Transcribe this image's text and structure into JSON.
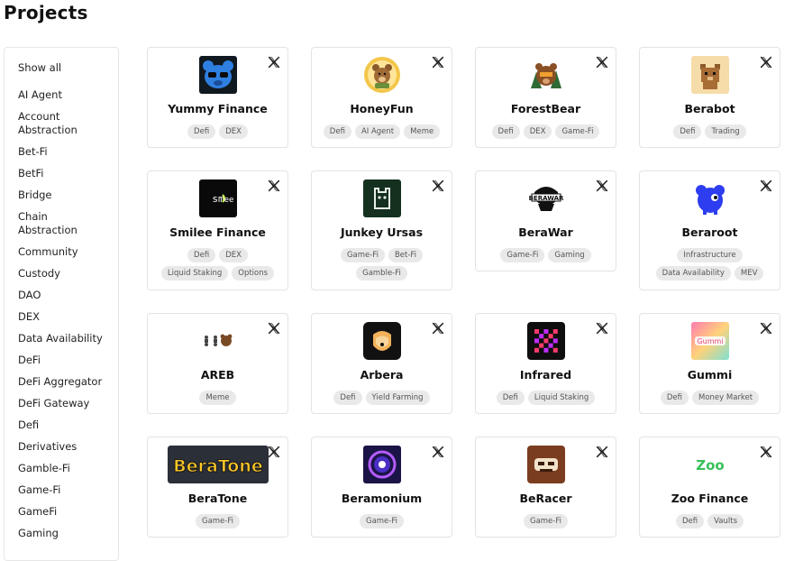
{
  "page": {
    "title": "Projects"
  },
  "sidebar": {
    "items": [
      {
        "label": "Show all"
      },
      {
        "label": "AI Agent"
      },
      {
        "label": "Account\nAbstraction"
      },
      {
        "label": "Bet-Fi"
      },
      {
        "label": "BetFi"
      },
      {
        "label": "Bridge"
      },
      {
        "label": "Chain\nAbstraction"
      },
      {
        "label": "Community"
      },
      {
        "label": "Custody"
      },
      {
        "label": "DAO"
      },
      {
        "label": "DEX"
      },
      {
        "label": "Data Availability"
      },
      {
        "label": "DeFi"
      },
      {
        "label": "DeFi Aggregator"
      },
      {
        "label": "DeFi Gateway"
      },
      {
        "label": "Defi"
      },
      {
        "label": "Derivatives"
      },
      {
        "label": "Gamble-Fi"
      },
      {
        "label": "Game-Fi"
      },
      {
        "label": "GameFi"
      },
      {
        "label": "Gaming"
      }
    ]
  },
  "projects": [
    {
      "name": "Yummy Finance",
      "tags": [
        "Defi",
        "DEX"
      ],
      "logo": "blue-bear-logo"
    },
    {
      "name": "HoneyFun",
      "tags": [
        "Defi",
        "AI Agent",
        "Meme"
      ],
      "logo": "honey-bear-logo"
    },
    {
      "name": "ForestBear",
      "tags": [
        "Defi",
        "DEX",
        "Game-Fi"
      ],
      "logo": "forest-bear-logo"
    },
    {
      "name": "Berabot",
      "tags": [
        "Defi",
        "Trading"
      ],
      "logo": "pixel-bear-logo"
    },
    {
      "name": "Smilee Finance",
      "tags": [
        "Defi",
        "DEX",
        "Liquid Staking",
        "Options"
      ],
      "logo": "smilee-logo"
    },
    {
      "name": "Junkey Ursas",
      "tags": [
        "Game-Fi",
        "Bet-Fi",
        "Gamble-Fi"
      ],
      "logo": "junkey-logo"
    },
    {
      "name": "BeraWar",
      "tags": [
        "Game-Fi",
        "Gaming"
      ],
      "logo": "berawar-logo"
    },
    {
      "name": "Beraroot",
      "tags": [
        "Infrastructure",
        "Data Availability",
        "MEV"
      ],
      "logo": "beraroot-logo"
    },
    {
      "name": "AREB",
      "tags": [
        "Meme"
      ],
      "logo": "areb-logo"
    },
    {
      "name": "Arbera",
      "tags": [
        "Defi",
        "Yield Farming"
      ],
      "logo": "arbera-logo"
    },
    {
      "name": "Infrared",
      "tags": [
        "Defi",
        "Liquid Staking"
      ],
      "logo": "infrared-logo"
    },
    {
      "name": "Gummi",
      "tags": [
        "Defi",
        "Money Market"
      ],
      "logo": "gummi-logo",
      "logo_text": "Gummi"
    },
    {
      "name": "BeraTone",
      "tags": [
        "Game-Fi"
      ],
      "logo": "beratone-logo",
      "logo_text": "BeraTone"
    },
    {
      "name": "Beramonium",
      "tags": [
        "Game-Fi"
      ],
      "logo": "beramonium-logo"
    },
    {
      "name": "BeRacer",
      "tags": [
        "Game-Fi"
      ],
      "logo": "beracer-logo"
    },
    {
      "name": "Zoo Finance",
      "tags": [
        "Defi",
        "Vaults"
      ],
      "logo": "zoo-logo",
      "logo_text": "Zoo"
    }
  ],
  "icons": {
    "social": "x-icon"
  },
  "colors": {
    "tag_bg": "#e9e9e9",
    "card_border": "#e3e3e3",
    "text": "#111111"
  }
}
